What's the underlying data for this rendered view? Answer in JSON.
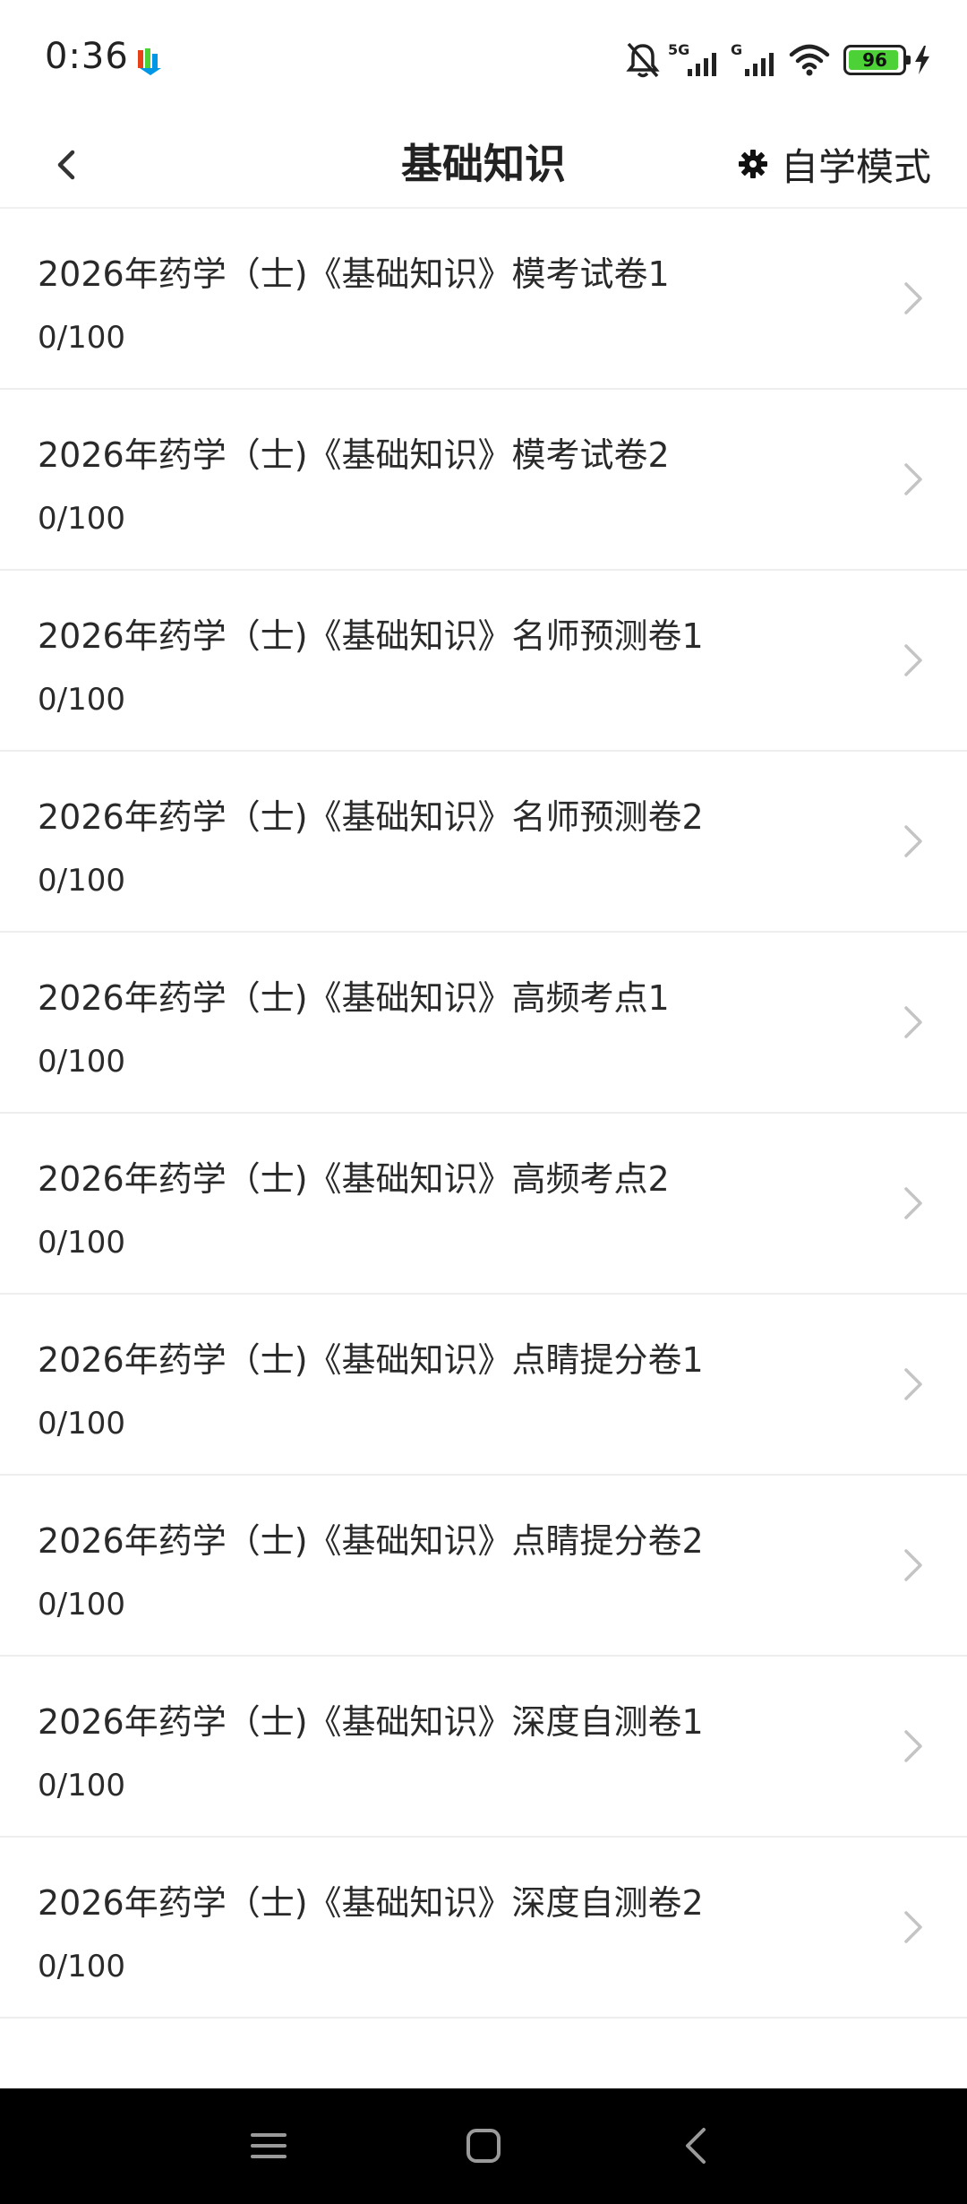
{
  "status_bar": {
    "time": "0:36",
    "network_1": "5G",
    "network_2": "G",
    "battery_percent": 96,
    "battery_text": "96",
    "icons": [
      "app-notification-icon",
      "mute-bell-icon",
      "signal-5g-icon",
      "signal-g-icon",
      "wifi-icon",
      "battery-icon",
      "charging-bolt-icon"
    ]
  },
  "header": {
    "title": "基础知识",
    "mode_label": "自学模式",
    "back_icon": "chevron-left-icon",
    "mode_icon": "gear-icon"
  },
  "exams": [
    {
      "title": "2026年药学（士)《基础知识》模考试卷1",
      "score": "0/100"
    },
    {
      "title": "2026年药学（士)《基础知识》模考试卷2",
      "score": "0/100"
    },
    {
      "title": "2026年药学（士)《基础知识》名师预测卷1",
      "score": "0/100"
    },
    {
      "title": "2026年药学（士)《基础知识》名师预测卷2",
      "score": "0/100"
    },
    {
      "title": "2026年药学（士)《基础知识》高频考点1",
      "score": "0/100"
    },
    {
      "title": "2026年药学（士)《基础知识》高频考点2",
      "score": "0/100"
    },
    {
      "title": "2026年药学（士)《基础知识》点睛提分卷1",
      "score": "0/100"
    },
    {
      "title": "2026年药学（士)《基础知识》点睛提分卷2",
      "score": "0/100"
    },
    {
      "title": "2026年药学（士)《基础知识》深度自测卷1",
      "score": "0/100"
    },
    {
      "title": "2026年药学（士)《基础知识》深度自测卷2",
      "score": "0/100"
    }
  ],
  "nav_bar": {
    "icons": [
      "menu-icon",
      "home-icon",
      "back-icon"
    ]
  },
  "colors": {
    "battery_fill": "#4cd137",
    "nav_background": "#000000",
    "text": "#2a2a2a",
    "chevron": "#c4c4c4"
  }
}
